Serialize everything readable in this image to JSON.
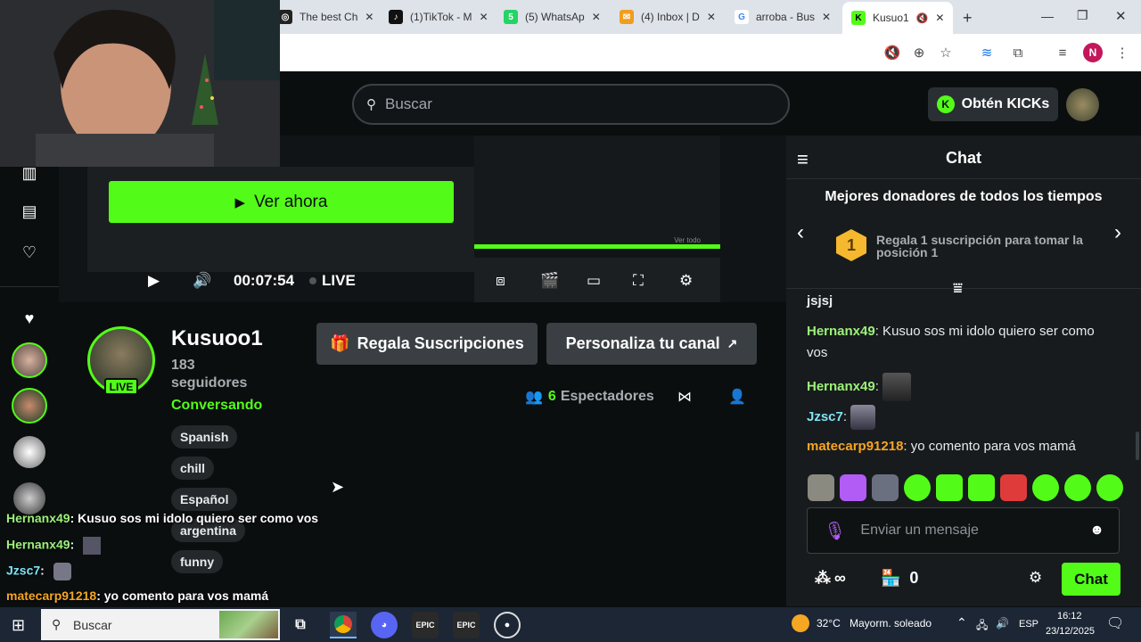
{
  "browser": {
    "tabs": [
      {
        "title": "The best Ch",
        "icon": "chatgpt-icon"
      },
      {
        "title": "(1)TikTok - M",
        "icon": "tiktok-icon"
      },
      {
        "title": "(5) WhatsAp",
        "icon": "whatsapp-icon"
      },
      {
        "title": "(4) Inbox | D",
        "icon": "inbox-icon"
      },
      {
        "title": "arroba - Bus",
        "icon": "google-icon"
      },
      {
        "title": "Kusuo1",
        "icon": "kick-icon",
        "active": true
      }
    ],
    "profile_initial": "N"
  },
  "header": {
    "search_placeholder": "Buscar",
    "kicks_label": "Obtén KICKs"
  },
  "player": {
    "watch_now_label": "Ver ahora",
    "time": "00:07:54",
    "live_label": "LIVE",
    "inner_caption": "Ver todo"
  },
  "channel": {
    "name": "Kusuoo1",
    "followers_count": "183",
    "followers_label": "seguidores",
    "category": "Conversando",
    "live_badge": "LIVE",
    "tags": [
      "Spanish",
      "chill",
      "Español",
      "argentina",
      "funny"
    ],
    "gift_button": "Regala Suscripciones",
    "customize_button": "Personaliza tu canal",
    "viewers_count": "6",
    "viewers_label": "Espectadores"
  },
  "overlay_chat": [
    {
      "user": "Hernanx49",
      "text": ": Kusuo sos mi idolo quiero ser como vos",
      "color": "#9cf27a"
    },
    {
      "user": "Hernanx49",
      "text": ":",
      "color": "#9cf27a"
    },
    {
      "user": "Jzsc7",
      "text": ":",
      "color": "#7ee3f5"
    },
    {
      "user": "matecarp91218",
      "text": ": yo comento para vos mamá",
      "color": "#f5a623"
    }
  ],
  "chat": {
    "title": "Chat",
    "donors_title": "Mejores donadores de todos los tiempos",
    "donor_rank": "1",
    "donor_text": "Regala 1 suscripción para tomar la posición 1",
    "partial_message": "jsjsj",
    "messages": [
      {
        "user": "Hernanx49",
        "text": " Kusuo sos mi idolo quiero ser como vos",
        "color": "#9cf27a"
      },
      {
        "user": "Hernanx49",
        "text": "",
        "color": "#9cf27a",
        "emote": true
      },
      {
        "user": "Jzsc7",
        "text": "",
        "color": "#7ee3f5",
        "emote": true
      },
      {
        "user": "matecarp91218",
        "text": " yo comento para vos mamá",
        "color": "#f5a623"
      }
    ],
    "input_placeholder": "Enviar un mensaje",
    "points_value": "0",
    "send_label": "Chat"
  },
  "taskbar": {
    "search_placeholder": "Buscar",
    "weather_temp": "32°C",
    "weather_text": "Mayorm. soleado",
    "lang": "ESP",
    "time": "16:12",
    "date": "23/12/2025"
  },
  "colors": {
    "accent": "#53fc18",
    "background": "#0b0e0f",
    "panel": "#181b1d"
  }
}
